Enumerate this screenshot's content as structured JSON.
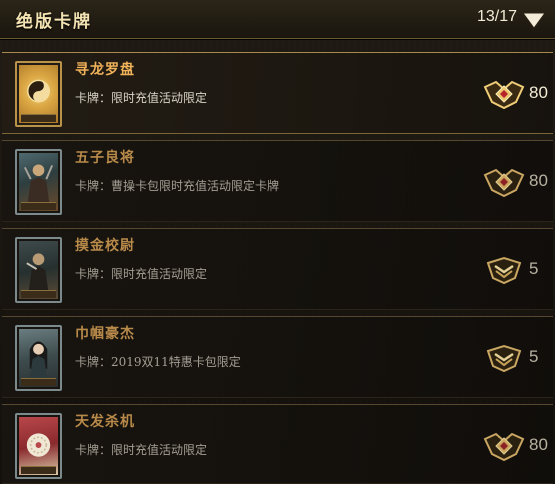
{
  "header": {
    "title": "绝版卡牌",
    "count": "13/17"
  },
  "colors": {
    "name_gold": "#f0b25a",
    "name_dim": "#b88a4a",
    "badge_gold": "#e8c36a"
  },
  "items": [
    {
      "name": "寻龙罗盘",
      "desc": "卡牌：限时充值活动限定",
      "value": "80",
      "state": "active"
    },
    {
      "name": "五子良将",
      "desc": "卡牌：曹操卡包限时充值活动限定卡牌",
      "value": "80",
      "state": "dim"
    },
    {
      "name": "摸金校尉",
      "desc": "卡牌：限时充值活动限定",
      "value": "5",
      "state": "dim"
    },
    {
      "name": "巾帼豪杰",
      "desc": "卡牌：2019双11特惠卡包限定",
      "value": "5",
      "state": "dim"
    },
    {
      "name": "天发杀机",
      "desc": "卡牌：限时充值活动限定",
      "value": "80",
      "state": "dim"
    }
  ]
}
